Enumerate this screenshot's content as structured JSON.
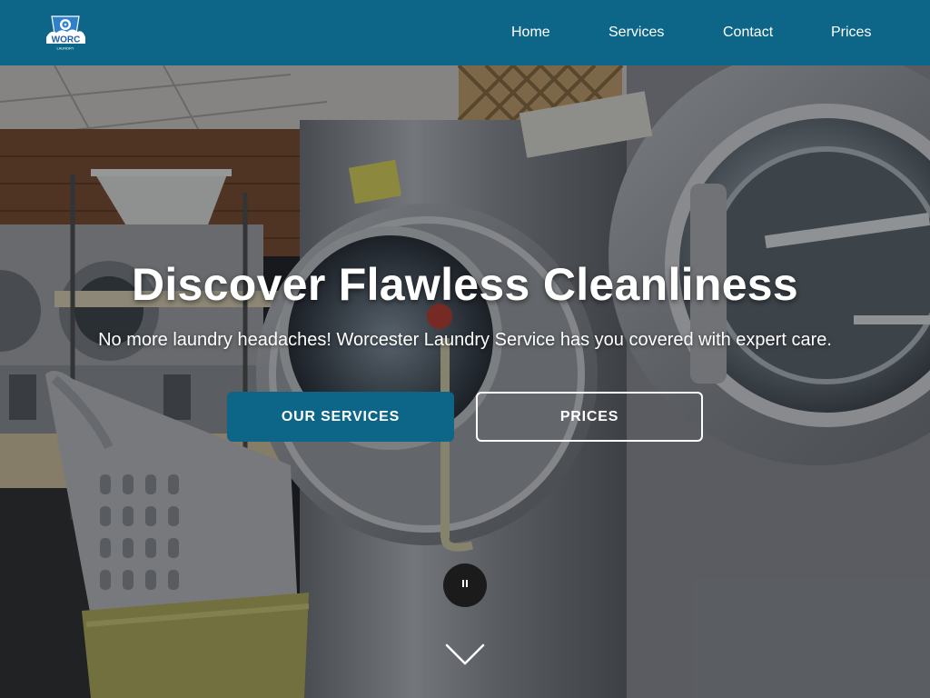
{
  "header": {
    "logo_alt": "WORC LAUNDRY",
    "nav": [
      {
        "label": "Home"
      },
      {
        "label": "Services"
      },
      {
        "label": "Contact"
      },
      {
        "label": "Prices"
      }
    ]
  },
  "hero": {
    "headline": "Discover Flawless Cleanliness",
    "subline": "No more laundry headaches! Worcester Laundry Service has you covered with expert care.",
    "primary_button": "OUR SERVICES",
    "secondary_button": "PRICES",
    "pause_icon": "pause-icon",
    "scroll_icon": "chevron-down-icon"
  },
  "colors": {
    "header": "#0d6687",
    "primary_button": "#0d6687",
    "text": "#ffffff"
  }
}
